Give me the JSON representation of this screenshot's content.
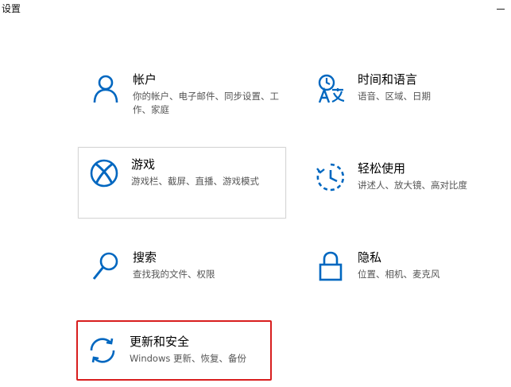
{
  "window": {
    "title": "设置"
  },
  "tiles": [
    {
      "key": "accounts",
      "title": "帐户",
      "desc": "你的帐户、电子邮件、同步设置、工作、家庭",
      "icon": "person-icon"
    },
    {
      "key": "time-language",
      "title": "时间和语言",
      "desc": "语音、区域、日期",
      "icon": "time-language-icon"
    },
    {
      "key": "gaming",
      "title": "游戏",
      "desc": "游戏栏、截屏、直播、游戏模式",
      "icon": "xbox-icon"
    },
    {
      "key": "ease-of-access",
      "title": "轻松使用",
      "desc": "讲述人、放大镜、高对比度",
      "icon": "ease-of-access-icon"
    },
    {
      "key": "search",
      "title": "搜索",
      "desc": "查找我的文件、权限",
      "icon": "search-icon"
    },
    {
      "key": "privacy",
      "title": "隐私",
      "desc": "位置、相机、麦克风",
      "icon": "lock-icon"
    },
    {
      "key": "update-security",
      "title": "更新和安全",
      "desc": "Windows 更新、恢复、备份",
      "icon": "sync-icon"
    }
  ],
  "colors": {
    "accent": "#0067c0",
    "highlight_border": "#d81e1e",
    "hover_border": "#d6d6d6",
    "desc_text": "#555555"
  }
}
